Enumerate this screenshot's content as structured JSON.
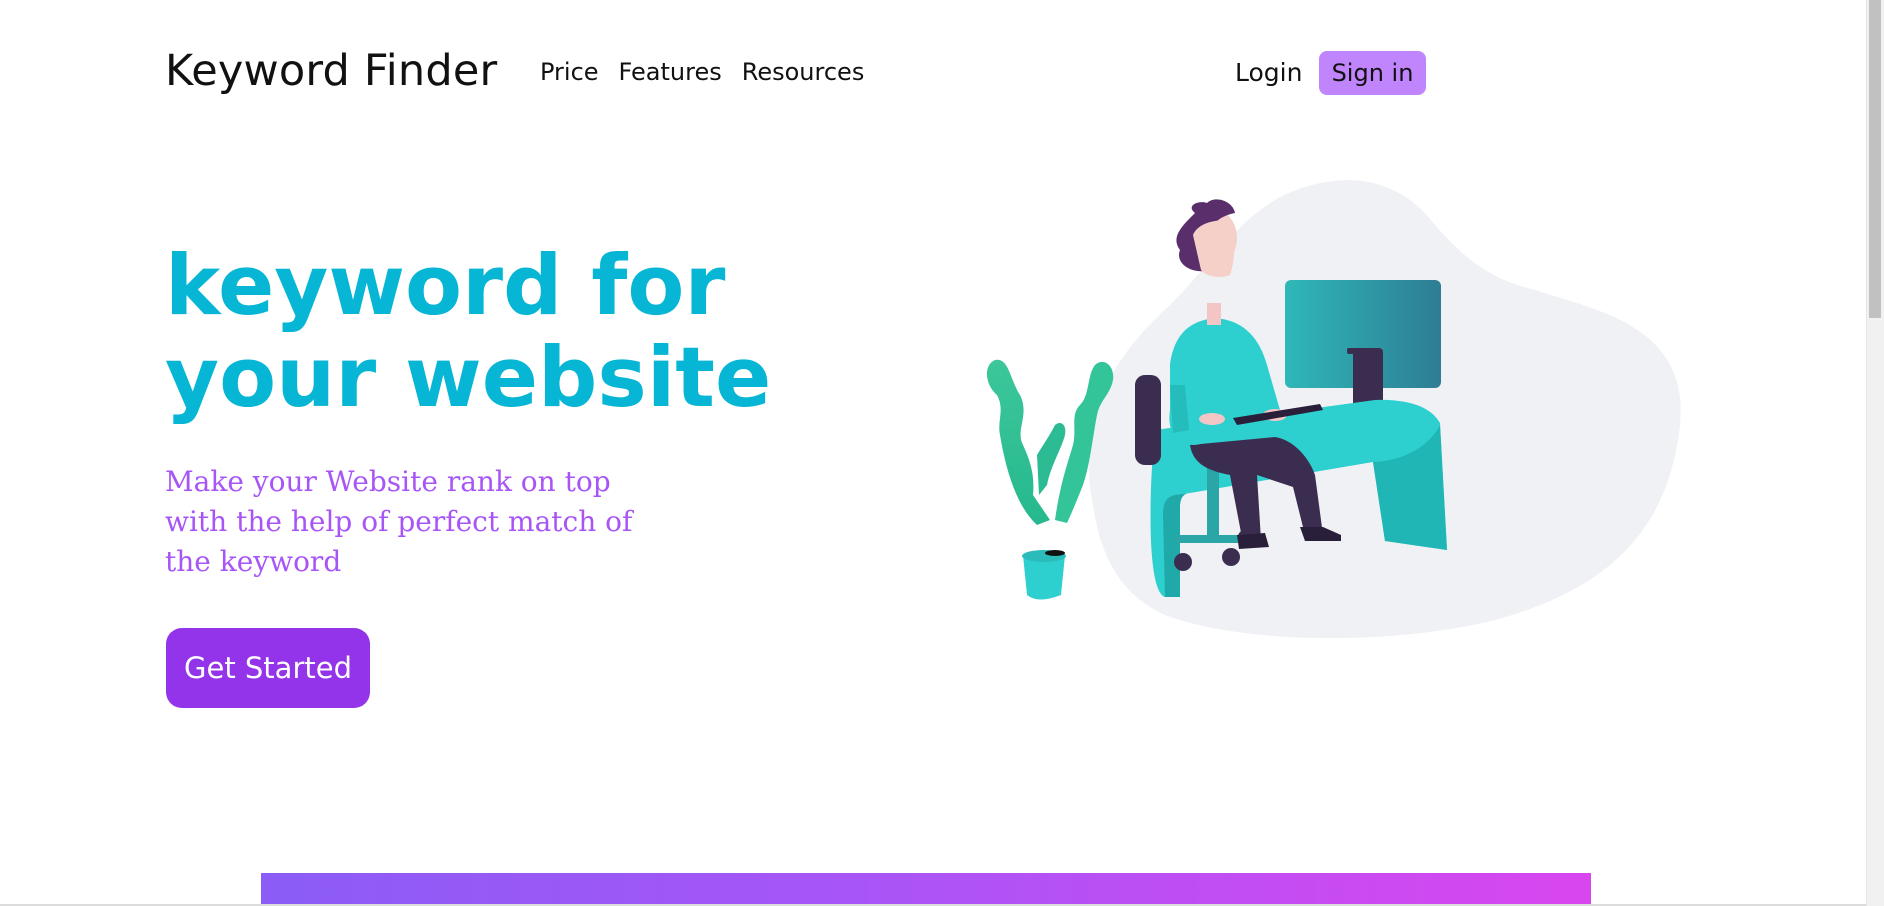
{
  "header": {
    "brand": "Keyword Finder",
    "nav": [
      {
        "label": "Price"
      },
      {
        "label": "Features"
      },
      {
        "label": "Resources"
      }
    ],
    "login_label": "Login",
    "signin_label": "Sign in"
  },
  "hero": {
    "title": "keyword for your website",
    "subtitle": "Make your Website rank on top with the help of perfect match of the keyword",
    "cta_label": "Get Started"
  },
  "illustration": {
    "name": "person-at-desk-illustration"
  },
  "colors": {
    "title": "#06b6d4",
    "subtitle": "#a855f7",
    "cta_background": "#9333ea",
    "signin_background": "#c084fc",
    "gradient_start": "#8b5cf6",
    "gradient_end": "#d946ef"
  }
}
